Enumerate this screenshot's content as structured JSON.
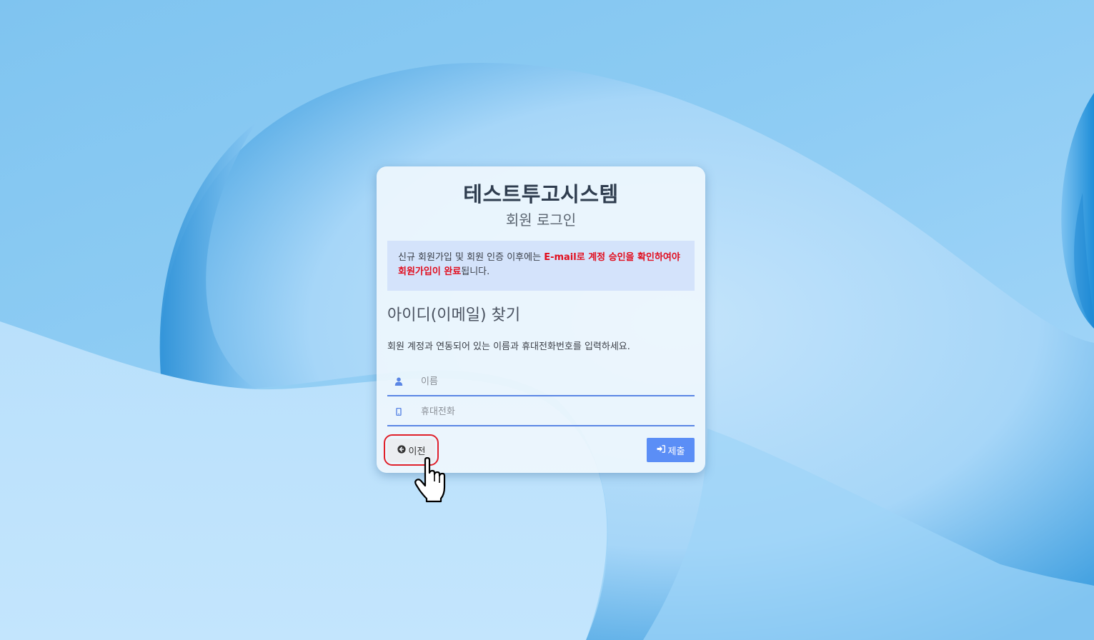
{
  "app": {
    "title": "테스트투고시스템",
    "subtitle": "회원 로그인"
  },
  "notice": {
    "text_before": "신규 회원가입 및 회원 인증 이후에는 ",
    "text_emphasis": "E-mail로 계정 승인을 확인하여야 회원가입이 완료",
    "text_after": "됩니다."
  },
  "find_id": {
    "title": "아이디(이메일) 찾기",
    "instruction": "회원 계정과 연동되어 있는 이름과 휴대전화번호를 입력하세요.",
    "name_field": {
      "placeholder": "이름",
      "value": "",
      "icon": "user-icon"
    },
    "phone_field": {
      "placeholder": "휴대전화",
      "value": "",
      "icon": "mobile-icon"
    }
  },
  "buttons": {
    "prev_label": "이전",
    "prev_icon": "arrow-circle-left-icon",
    "submit_label": "제출",
    "submit_icon": "sign-in-icon"
  },
  "colors": {
    "accent": "#5b8ef6",
    "emphasis": "#e10d1e",
    "notice_bg": "#d4e3fb",
    "highlight": "#e0202a"
  }
}
